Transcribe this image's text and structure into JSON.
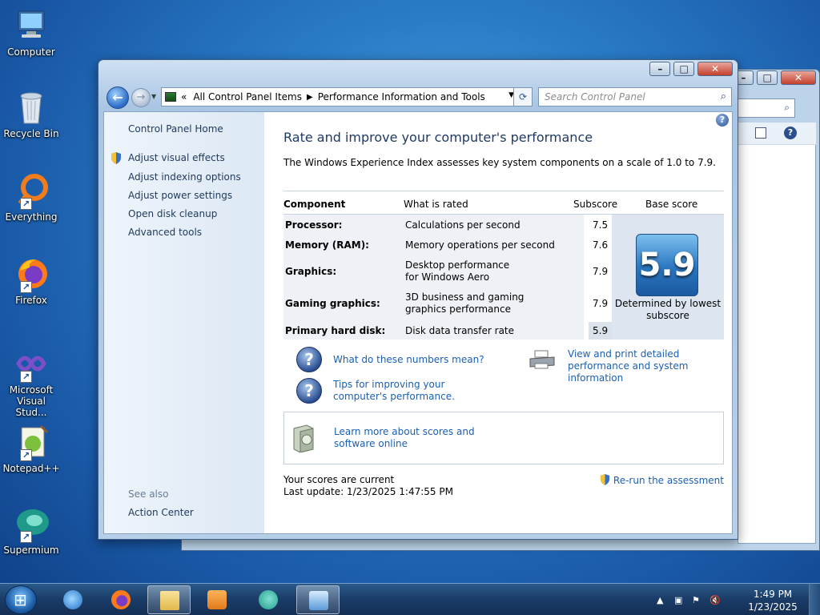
{
  "desktop": {
    "icons": [
      {
        "label": "Computer"
      },
      {
        "label": "Recycle Bin"
      },
      {
        "label": "Everything"
      },
      {
        "label": "Firefox"
      },
      {
        "label": "Microsoft Visual Stud..."
      },
      {
        "label": "Notepad++"
      },
      {
        "label": "Supermium"
      }
    ]
  },
  "window": {
    "address": {
      "prefix": "«",
      "crumb1": "All Control Panel Items",
      "crumb2": "Performance Information and Tools"
    },
    "search_placeholder": "Search Control Panel",
    "sidebar": {
      "home": "Control Panel Home",
      "links": [
        "Adjust visual effects",
        "Adjust indexing options",
        "Adjust power settings",
        "Open disk cleanup",
        "Advanced tools"
      ],
      "see_also": "See also",
      "action_center": "Action Center"
    },
    "title": "Rate and improve your computer's performance",
    "intro": "The Windows Experience Index assesses key system components on a scale of 1.0 to 7.9.",
    "table": {
      "headers": {
        "component": "Component",
        "rated": "What is rated",
        "subscore": "Subscore",
        "base": "Base score"
      },
      "rows": [
        {
          "component": "Processor:",
          "rated": "Calculations per second",
          "subscore": "7.5"
        },
        {
          "component": "Memory (RAM):",
          "rated": "Memory operations per second",
          "subscore": "7.6"
        },
        {
          "component": "Graphics:",
          "rated": "Desktop performance for Windows Aero",
          "subscore": "7.9"
        },
        {
          "component": "Gaming graphics:",
          "rated": "3D business and gaming graphics performance",
          "subscore": "7.9"
        },
        {
          "component": "Primary hard disk:",
          "rated": "Disk data transfer rate",
          "subscore": "5.9"
        }
      ],
      "base_score": "5.9",
      "base_caption": "Determined by lowest subscore"
    },
    "links": {
      "numbers": "What do these numbers mean?",
      "tips": "Tips for improving your computer's performance.",
      "print": "View and print detailed performance and system information",
      "learn": "Learn more about scores and software online"
    },
    "status": {
      "current": "Your scores are current",
      "last_update": "Last update: 1/23/2025 1:47:55 PM"
    },
    "rerun": "Re-run the assessment"
  },
  "taskbar": {
    "time": "1:49 PM",
    "date": "1/23/2025"
  }
}
